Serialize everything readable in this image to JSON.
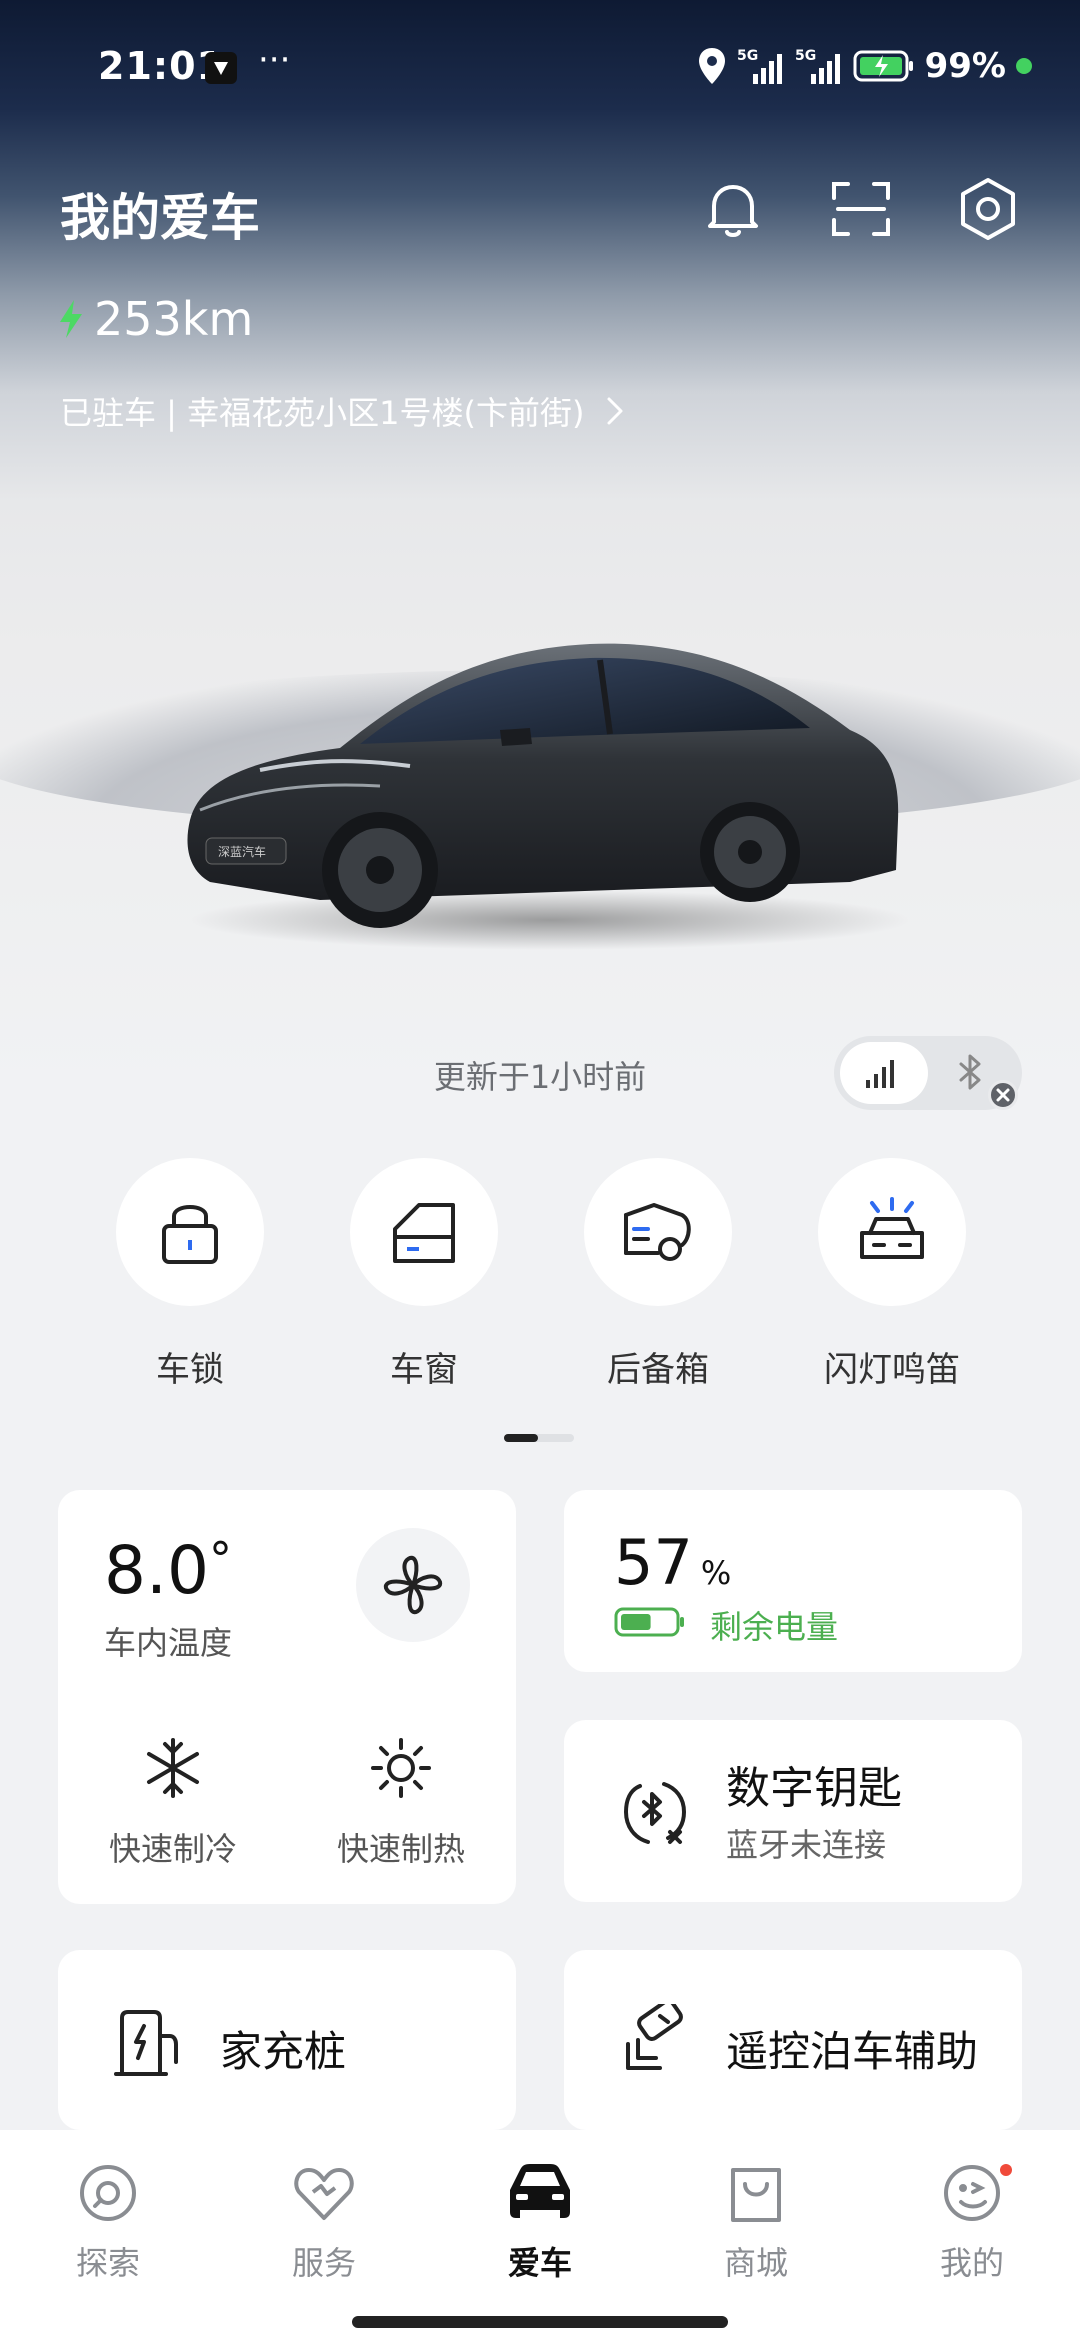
{
  "status_bar": {
    "time": "21:01",
    "dots": "···",
    "network_1": "5G",
    "network_2": "5G",
    "battery_percent": "99%"
  },
  "header": {
    "title": "我的爱车",
    "icons": [
      "bell-icon",
      "scan-icon",
      "settings-icon"
    ]
  },
  "range": {
    "value": "253km",
    "icon": "lightning-icon",
    "color": "#4cd964"
  },
  "location": {
    "text": "已驻车 | 幸福花苑小区1号楼(卞前街)",
    "chevron": "chevron-right-icon"
  },
  "car_badge": "深蓝汽车",
  "update": {
    "text": "更新于1小时前"
  },
  "connection": {
    "options": [
      "signal-icon",
      "bluetooth-icon"
    ],
    "selected": "signal-icon"
  },
  "controls": [
    {
      "label": "车锁",
      "icon": "lock-icon"
    },
    {
      "label": "车窗",
      "icon": "window-icon"
    },
    {
      "label": "后备箱",
      "icon": "trunk-icon"
    },
    {
      "label": "闪灯鸣笛",
      "icon": "flash-horn-icon"
    }
  ],
  "pagination": {
    "current": 1,
    "total": 2
  },
  "climate": {
    "temperature": "8.0",
    "degree": "°",
    "label": "车内温度",
    "quick_cool": "快速制冷",
    "quick_heat": "快速制热"
  },
  "battery": {
    "value": "57",
    "unit": "%",
    "label": "剩余电量",
    "level": 0.57,
    "color": "#4caf50"
  },
  "digital_key": {
    "title": "数字钥匙",
    "subtitle": "蓝牙未连接"
  },
  "home_charger": {
    "title": "家充桩"
  },
  "remote_parking": {
    "title": "遥控泊车辅助"
  },
  "tabbar": {
    "tabs": [
      {
        "label": "探索",
        "icon": "explore-icon"
      },
      {
        "label": "服务",
        "icon": "service-icon"
      },
      {
        "label": "爱车",
        "icon": "car-icon"
      },
      {
        "label": "商城",
        "icon": "shop-icon"
      },
      {
        "label": "我的",
        "icon": "profile-icon"
      }
    ],
    "active": 2
  }
}
